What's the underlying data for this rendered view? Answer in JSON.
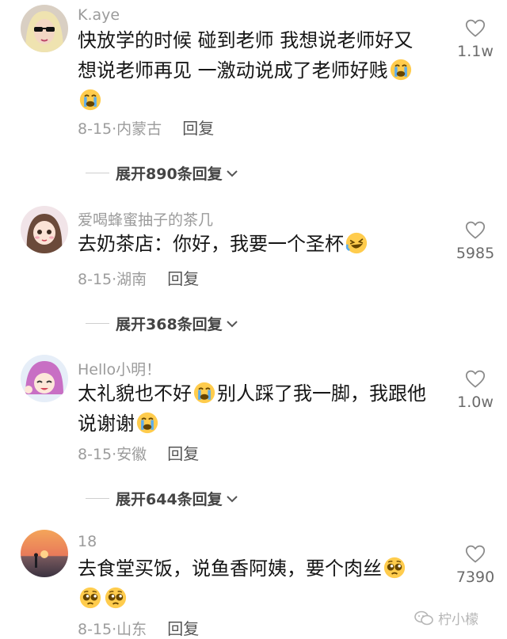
{
  "comments": [
    {
      "username": "K.aye",
      "text": "快放学的时候  碰到老师  我想说老师好又想说老师再见  一激动说成了老师好贱",
      "date": "8-15",
      "location": "内蒙古",
      "reply_label": "回复",
      "likes": "1.1w",
      "expand": "展开890条回复"
    },
    {
      "username": "爱喝蜂蜜抽子的茶几",
      "text": "去奶茶店：你好，我要一个圣杯",
      "date": "8-15",
      "location": "湖南",
      "reply_label": "回复",
      "likes": "5985",
      "expand": "展开368条回复"
    },
    {
      "username": "Hello小明！",
      "text_part1": "太礼貌也不好",
      "text_part2": "别人踩了我一脚，我跟他说谢谢",
      "date": "8-15",
      "location": "安徽",
      "reply_label": "回复",
      "likes": "1.0w",
      "expand": "展开644条回复"
    },
    {
      "username": "18",
      "text": "去食堂买饭，说鱼香阿姨，要个肉丝",
      "date": "8-15",
      "location": "山东",
      "reply_label": "回复",
      "likes": "7390"
    }
  ],
  "watermark": "柠小檬",
  "icons": {
    "like": "heart-outline-icon",
    "expand": "chevron-down-icon",
    "crying": "loudly-crying-face-icon",
    "laughing": "rolling-laughing-face-icon",
    "pleading": "pleading-face-icon",
    "wechat": "wechat-icon"
  }
}
